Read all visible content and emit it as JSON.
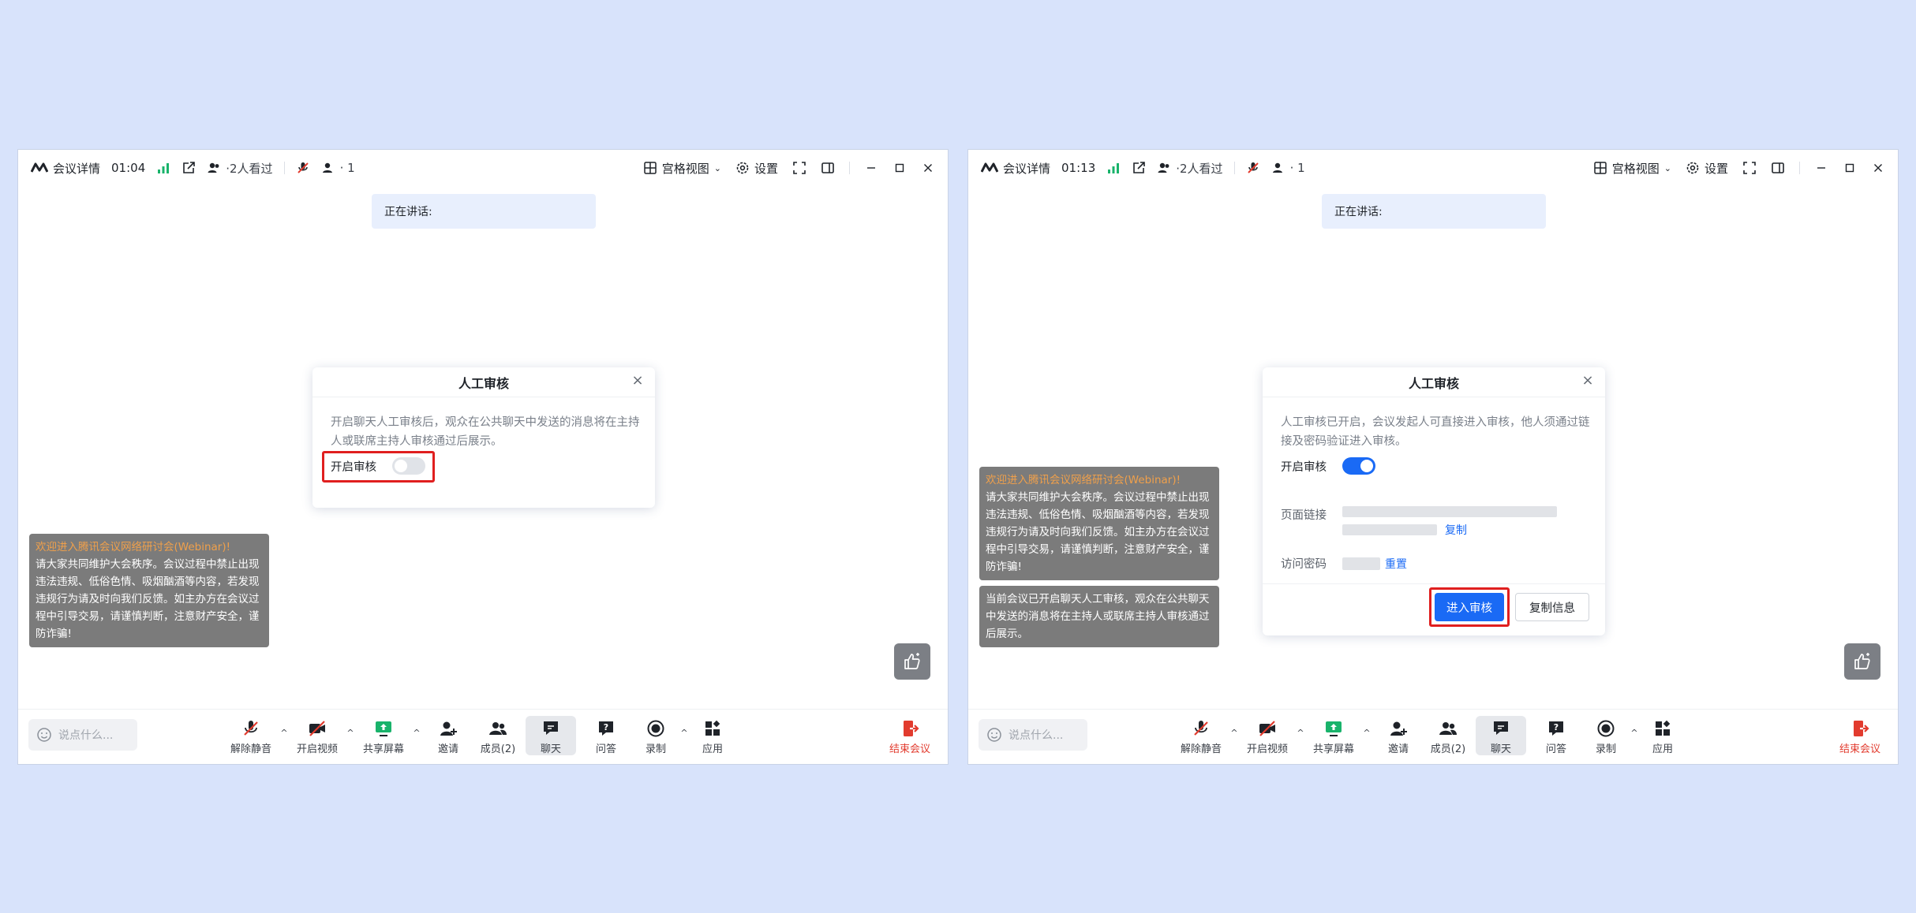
{
  "common": {
    "meeting_details": "会议详情",
    "viewed_count": "·2人看过",
    "attendee_count": "· 1",
    "grid_view": "宫格视图",
    "settings": "设置",
    "speaking": "正在讲话:",
    "dialog_title": "人工审核",
    "close_glyph": "×",
    "welcome_title": "欢迎进入腾讯会议网络研讨会(Webinar)!",
    "chat_placeholder": "说点什么...",
    "toolbar": {
      "unmute": "解除静音",
      "start_video": "开启视频",
      "share_screen": "共享屏幕",
      "invite": "邀请",
      "members": "成员(2)",
      "chat": "聊天",
      "qa": "问答",
      "record": "录制",
      "apps": "应用",
      "end_meeting": "结束会议"
    }
  },
  "left": {
    "timer": "01:04",
    "dialog_desc": "开启聊天人工审核后，观众在公共聊天中发送的消息将在主持人或联席主持人审核通过后展示。",
    "toggle_label": "开启审核",
    "toggle_state": "off",
    "welcome_body": "请大家共同维护大会秩序。会议过程中禁止出现违法违规、低俗色情、吸烟酗酒等内容，若发现违规行为请及时向我们反馈。如主办方在会议过程中引导交易，请谨慎判断，注意财产安全，谨防诈骗!"
  },
  "right": {
    "timer": "01:13",
    "dialog_desc": "人工审核已开启，会议发起人可直接进入审核，他人须通过链接及密码验证进入审核。",
    "toggle_label": "开启审核",
    "toggle_state": "on",
    "link_label": "页面链接",
    "copy_label": "复制",
    "password_label": "访问密码",
    "reset_label": "重置",
    "enter_review": "进入审核",
    "copy_info": "复制信息",
    "welcome_body": "请大家共同维护大会秩序。会议过程中禁止出现违法违规、低俗色情、吸烟酗酒等内容，若发现违规行为请及时向我们反馈。如主办方在会议过程中引导交易，请谨慎判断，注意财产安全，谨防诈骗!",
    "review_notice": "当前会议已开启聊天人工审核，观众在公共聊天中发送的消息将在主持人或联席主持人审核通过后展示。"
  },
  "colors": {
    "accent": "#1a6af5",
    "highlight_box": "#e01f1f",
    "end_meeting": "#e23b2e",
    "welcome_title": "#f0a04b",
    "signal_bars": "#19b36b"
  }
}
